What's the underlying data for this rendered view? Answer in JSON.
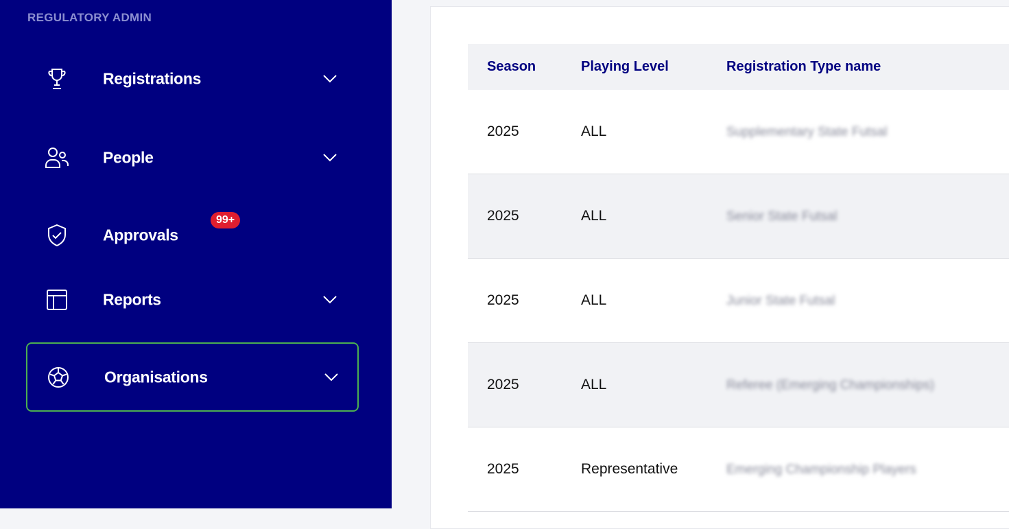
{
  "sidebar": {
    "section_title": "REGULATORY ADMIN",
    "items": [
      {
        "label": "Registrations",
        "icon": "trophy-icon",
        "has_chevron": true
      },
      {
        "label": "People",
        "icon": "people-icon",
        "has_chevron": true
      },
      {
        "label": "Approvals",
        "icon": "shield-check-icon",
        "has_chevron": false,
        "badge": "99+"
      },
      {
        "label": "Reports",
        "icon": "layout-icon",
        "has_chevron": true
      },
      {
        "label": "Organisations",
        "icon": "soccer-ball-icon",
        "has_chevron": true,
        "active": true
      }
    ]
  },
  "table": {
    "headers": {
      "season": "Season",
      "playing_level": "Playing Level",
      "registration_type": "Registration Type name"
    },
    "rows": [
      {
        "season": "2025",
        "playing_level": "ALL",
        "registration_type": "Supplementary State Futsal"
      },
      {
        "season": "2025",
        "playing_level": "ALL",
        "registration_type": "Senior State Futsal"
      },
      {
        "season": "2025",
        "playing_level": "ALL",
        "registration_type": "Junior State Futsal"
      },
      {
        "season": "2025",
        "playing_level": "ALL",
        "registration_type": "Referee (Emerging Championships)"
      },
      {
        "season": "2025",
        "playing_level": "Representative",
        "registration_type": "Emerging Championship Players"
      }
    ]
  },
  "colors": {
    "sidebar_bg": "#000080",
    "active_border": "#4caf50",
    "badge_bg": "#e01e2f",
    "header_text": "#000080"
  }
}
